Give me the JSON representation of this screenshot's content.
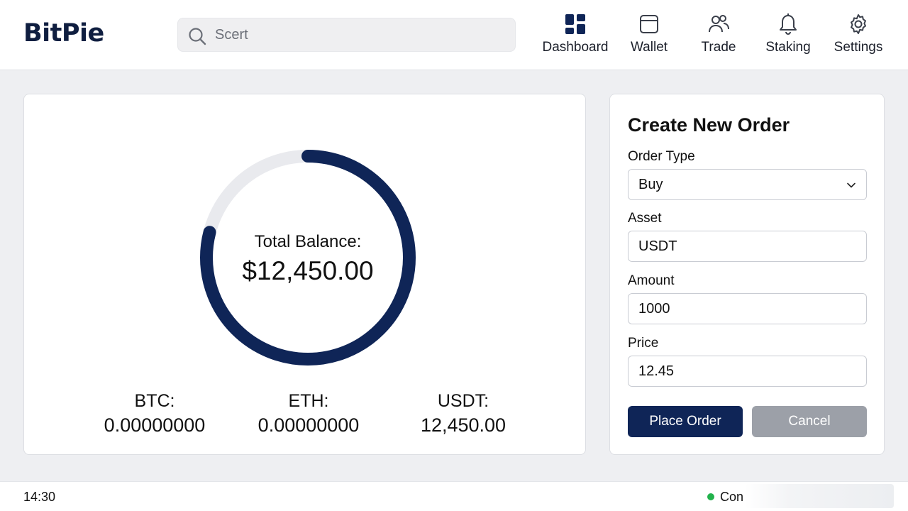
{
  "app": {
    "logo": "BitPie"
  },
  "search": {
    "value": "",
    "placeholder": "Scert"
  },
  "nav": [
    {
      "label": "Dashboard",
      "icon": "dashboard-icon"
    },
    {
      "label": "Wallet",
      "icon": "wallet-icon"
    },
    {
      "label": "Trade",
      "icon": "users-icon"
    },
    {
      "label": "Staking",
      "icon": "bell-icon"
    },
    {
      "label": "Settings",
      "icon": "gear-icon"
    }
  ],
  "balance": {
    "label": "Total Balance:",
    "value": "$12,450.00",
    "ring_fill_fraction": 0.79,
    "assets": [
      {
        "name": "BTC:",
        "value": "0.00000000"
      },
      {
        "name": "ETH:",
        "value": "0.00000000"
      },
      {
        "name": "USDT:",
        "value": "12,450.00"
      }
    ]
  },
  "order": {
    "title": "Create New Order",
    "type_label": "Order Type",
    "type_value": "Buy",
    "asset_label": "Asset",
    "asset_value": "USDT",
    "amount_label": "Amount",
    "amount_value": "1000",
    "price_label": "Price",
    "price_value": "12.45",
    "submit_label": "Place Order",
    "cancel_label": "Cancel"
  },
  "status": {
    "time": "14:30",
    "connection": "Con"
  },
  "colors": {
    "brand": "#0f1e40",
    "primary": "#0f2557",
    "ring": "#0f2557",
    "ring_track": "#e9eaee",
    "secondary_button": "#9ca0a8",
    "status_ok": "#22b24c"
  }
}
